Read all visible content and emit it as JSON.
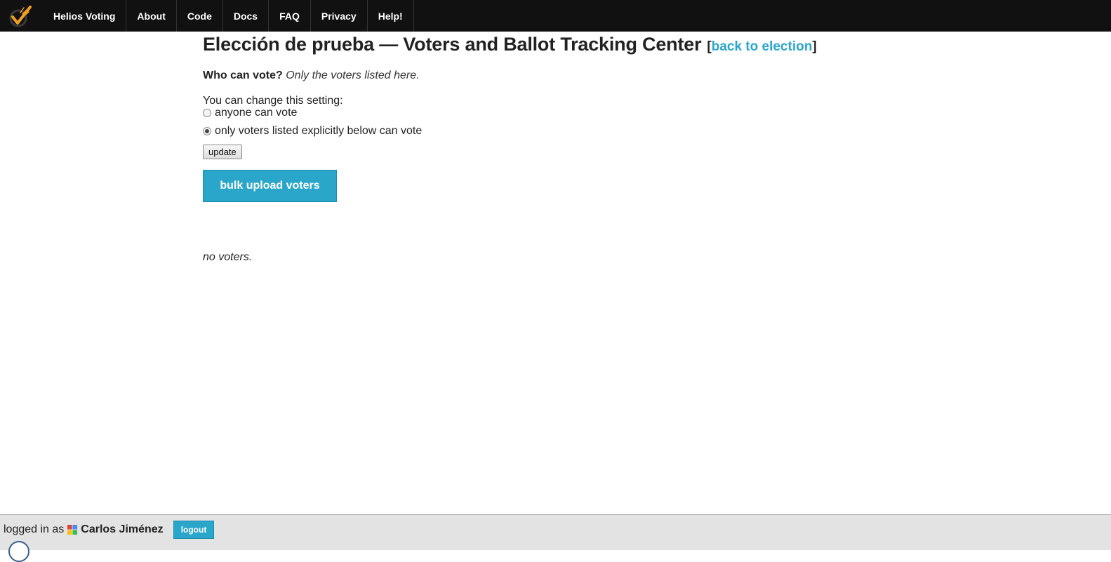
{
  "nav": {
    "logo_icon": "helios-check-logo-icon",
    "items": [
      {
        "label": "Helios Voting"
      },
      {
        "label": "About"
      },
      {
        "label": "Code"
      },
      {
        "label": "Docs"
      },
      {
        "label": "FAQ"
      },
      {
        "label": "Privacy"
      },
      {
        "label": "Help!"
      }
    ]
  },
  "page": {
    "title": "Elección de prueba — Voters and Ballot Tracking Center",
    "bracket_open": "[",
    "back_link": "back to election",
    "bracket_close": "]",
    "who_label": "Who can vote?",
    "who_value": "Only the voters listed here.",
    "change_label": "You can change this setting:",
    "options": [
      {
        "label": "anyone can vote",
        "checked": false
      },
      {
        "label": "only voters listed explicitly below can vote",
        "checked": true
      }
    ],
    "update_label": "update",
    "bulk_upload_label": "bulk upload voters",
    "no_voters": "no voters."
  },
  "footer": {
    "logged_in_label": "logged in as",
    "user_icon": "google-icon",
    "user_name": "Carlos Jiménez",
    "logout_label": "logout"
  },
  "colors": {
    "accent": "#2ba6cb",
    "topbar": "#111111",
    "footer": "#e3e3e3"
  }
}
